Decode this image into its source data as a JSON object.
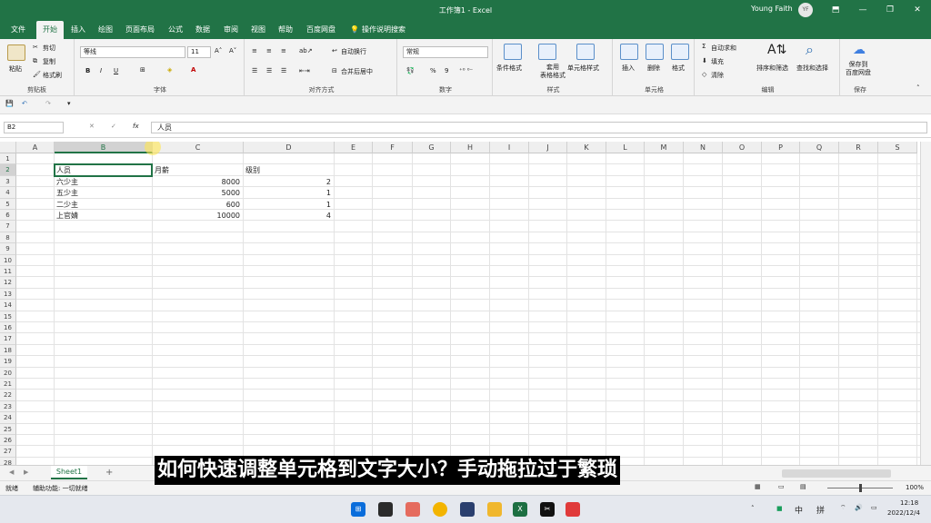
{
  "window": {
    "title": "工作簿1 - Excel",
    "user": "Young Faith",
    "avatar": "YF",
    "controls": [
      "⬒",
      "—",
      "❐",
      "✕"
    ]
  },
  "tabs": [
    "文件",
    "开始",
    "插入",
    "绘图",
    "页面布局",
    "公式",
    "数据",
    "审阅",
    "视图",
    "帮助",
    "百度网盘",
    "操作说明搜索"
  ],
  "ribbon": {
    "clipboard": {
      "paste": "粘贴",
      "cut": "剪切",
      "copy": "复制",
      "painter": "格式刷",
      "label": "剪贴板"
    },
    "font": {
      "name": "等线",
      "size": "11",
      "bold": "B",
      "italic": "I",
      "underline": "U",
      "label": "字体"
    },
    "align": {
      "wrap": "自动换行",
      "merge": "合并后居中",
      "label": "对齐方式"
    },
    "number": {
      "format": "常规",
      "percent": "%",
      "comma": "9",
      "label": "数字"
    },
    "styles": {
      "cond": "条件格式",
      "table": "套用\n表格格式",
      "cell": "单元格样式",
      "label": "样式"
    },
    "cells": {
      "insert": "插入",
      "delete": "删除",
      "format": "格式",
      "label": "单元格"
    },
    "editing": {
      "autosum": "自动求和",
      "fill": "填充",
      "clear": "清除",
      "sort": "排序和筛选",
      "find": "查找和选择",
      "label": "编辑"
    },
    "save": {
      "btn": "保存到\n百度网盘",
      "label": "保存"
    }
  },
  "formula": {
    "namebox": "B2",
    "fx": "fx",
    "content": "人员"
  },
  "columns": [
    "A",
    "B",
    "C",
    "D",
    "E",
    "F",
    "G",
    "H",
    "I",
    "J",
    "K",
    "L",
    "M",
    "N",
    "O",
    "P",
    "Q",
    "R",
    "S"
  ],
  "rows": [
    "1",
    "2",
    "3",
    "4",
    "5",
    "6",
    "7",
    "8",
    "9",
    "10",
    "11",
    "12",
    "13",
    "14",
    "15",
    "16",
    "17",
    "18",
    "19",
    "20",
    "21",
    "22",
    "23",
    "24",
    "25",
    "26",
    "27",
    "28"
  ],
  "headers": [
    "人员",
    "月薪",
    "级别"
  ],
  "data": [
    [
      "六少主",
      "8000",
      "2"
    ],
    [
      "五少主",
      "5000",
      "1"
    ],
    [
      "二少主",
      "600",
      "1"
    ],
    [
      "上官婧",
      "10000",
      "4"
    ]
  ],
  "sheet": {
    "name": "Sheet1",
    "add": "+"
  },
  "status": {
    "ready": "就绪",
    "access": "辅助功能: 一切就绪",
    "zoom": "100%"
  },
  "taskbar": {
    "ime1": "中",
    "ime2": "拼",
    "time": "12:18",
    "date": "2022/12/4"
  },
  "subtitle": "如何快速调整单元格到文字大小？手动拖拉过于繁琐"
}
